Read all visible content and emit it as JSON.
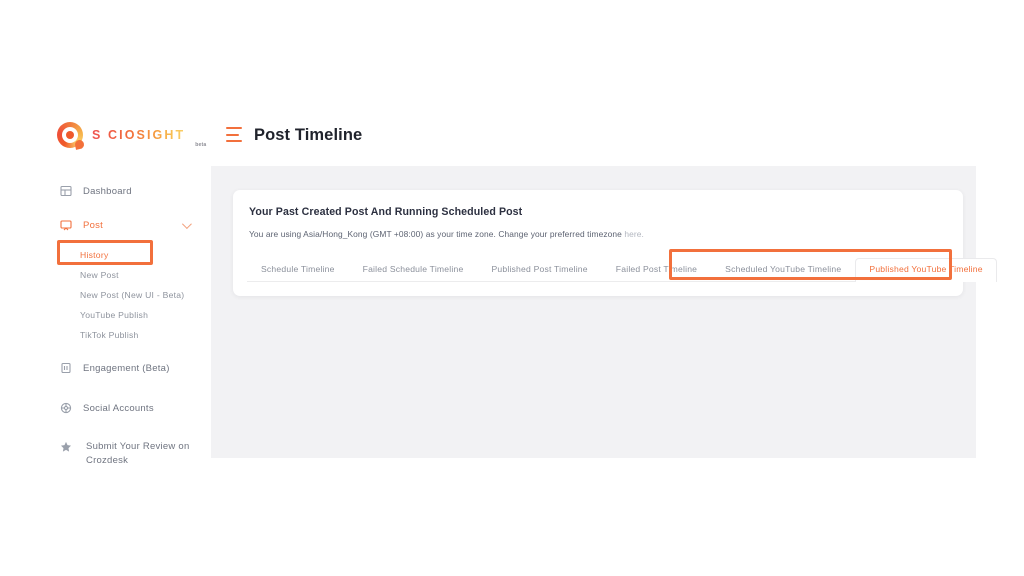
{
  "brand": {
    "logo_icon": "sociosight-circle-logo",
    "name": "S CIOSIGHT",
    "suffix": "beta"
  },
  "header": {
    "menu_icon": "hamburger-menu-icon",
    "title": "Post Timeline"
  },
  "sidebar": {
    "items": [
      {
        "label": "Dashboard",
        "icon": "dashboard-grid-icon",
        "active": false
      },
      {
        "label": "Post",
        "icon": "post-monitor-icon",
        "active": true,
        "expandable": true,
        "chevron": "chevron-down-icon"
      },
      {
        "label": "Engagement (Beta)",
        "icon": "engagement-clipboard-icon",
        "active": false
      },
      {
        "label": "Social Accounts",
        "icon": "social-globe-icon",
        "active": false
      },
      {
        "label": "Submit Your Review on Crozdesk",
        "icon": "star-icon",
        "active": false
      }
    ],
    "post_submenu": [
      {
        "label": "History",
        "current": true
      },
      {
        "label": "New Post",
        "current": false
      },
      {
        "label": "New Post (New UI - Beta)",
        "current": false
      },
      {
        "label": "YouTube Publish",
        "current": false
      },
      {
        "label": "TikTok Publish",
        "current": false
      }
    ]
  },
  "main": {
    "card_title": "Your Past Created Post And Running Scheduled Post",
    "timezone_text": "You are using Asia/Hong_Kong (GMT +08:00) as your time zone. Change your preferred timezone ",
    "timezone_link": "here.",
    "tabs": [
      {
        "label": "Schedule Timeline",
        "active": false
      },
      {
        "label": "Failed Schedule Timeline",
        "active": false
      },
      {
        "label": "Published Post Timeline",
        "active": false
      },
      {
        "label": "Failed Post Timeline",
        "active": false
      },
      {
        "label": "Scheduled YouTube Timeline",
        "active": false
      },
      {
        "label": "Published YouTube Timeline",
        "active": true
      }
    ]
  },
  "annotations": {
    "highlight_color": "#f2703c",
    "history_highlight": "History",
    "tabs_highlight": "Scheduled YouTube Timeline / Published YouTube Timeline"
  },
  "colors": {
    "accent": "#f2703c",
    "content_bg": "#f2f2f4",
    "card_bg": "#ffffff",
    "text_muted": "#8b909b"
  }
}
